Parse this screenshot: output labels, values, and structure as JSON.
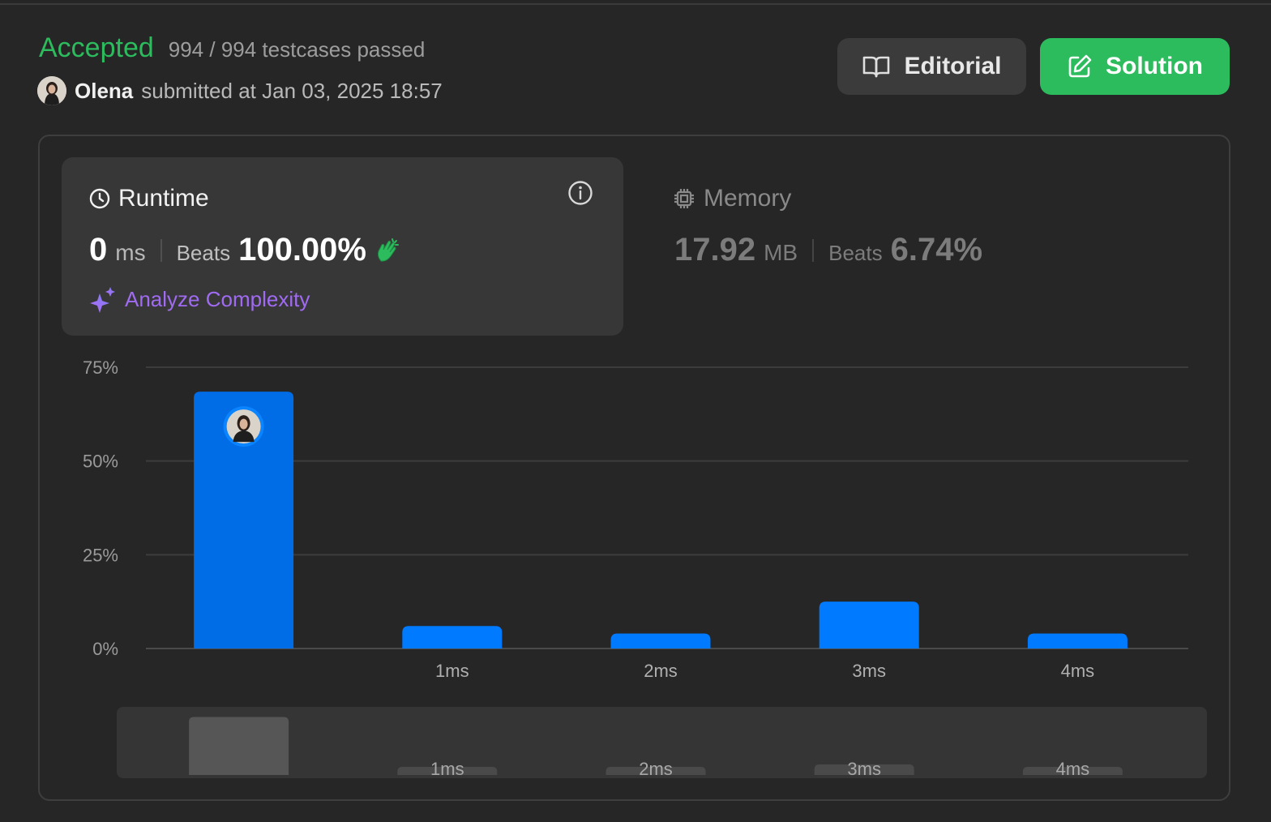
{
  "header": {
    "status": "Accepted",
    "testcases": "994 / 994 testcases passed",
    "username": "Olena",
    "submitted_text": "submitted at Jan 03, 2025 18:57",
    "editorial_label": "Editorial",
    "solution_label": "Solution"
  },
  "runtime": {
    "title": "Runtime",
    "value": "0",
    "unit": "ms",
    "beats_label": "Beats",
    "beats_value": "100.00%",
    "analyze_label": "Analyze Complexity"
  },
  "memory": {
    "title": "Memory",
    "value": "17.92",
    "unit": "MB",
    "beats_label": "Beats",
    "beats_value": "6.74%"
  },
  "colors": {
    "accent_green": "#2cbb5d",
    "bar_selected": "#006ce6",
    "bar": "#007aff",
    "analyze": "#a06bf2"
  },
  "chart_data": {
    "type": "bar",
    "categories": [
      "",
      "1ms",
      "2ms",
      "3ms",
      "4ms"
    ],
    "values": [
      68.5,
      6,
      4,
      12.5,
      4
    ],
    "ylim": [
      0,
      75
    ],
    "yticks": [
      0,
      25,
      50,
      75
    ],
    "ytick_labels": [
      "0%",
      "25%",
      "50%",
      "75%"
    ],
    "selected_index": 0,
    "grid": true
  }
}
